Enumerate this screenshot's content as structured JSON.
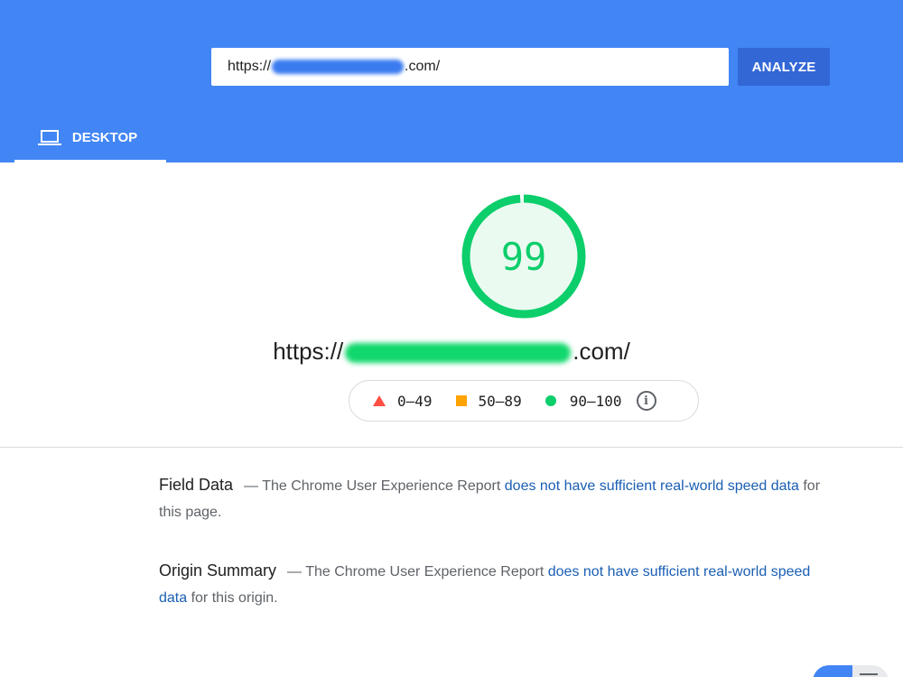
{
  "header": {
    "url_prefix": "https://",
    "url_suffix": ".com/",
    "analyze_label": "ANALYZE",
    "tab_label": "DESKTOP",
    "background_color": "#4285f4"
  },
  "score": {
    "value": "99",
    "color": "#0cce6b"
  },
  "site": {
    "url_prefix": "https://",
    "url_suffix": ".com/"
  },
  "legend": {
    "fail_range": "0–49",
    "average_range": "50–89",
    "pass_range": "90–100",
    "info_icon": "i"
  },
  "field_data": {
    "heading": "Field Data",
    "text_before": "— The Chrome User Experience Report ",
    "link": "does not have sufficient real-world speed data",
    "text_after": " for this page."
  },
  "origin_summary": {
    "heading": "Origin Summary",
    "text_before": "— The Chrome User Experience Report ",
    "link": "does not have sufficient real-world speed data",
    "text_after": " for this origin."
  }
}
